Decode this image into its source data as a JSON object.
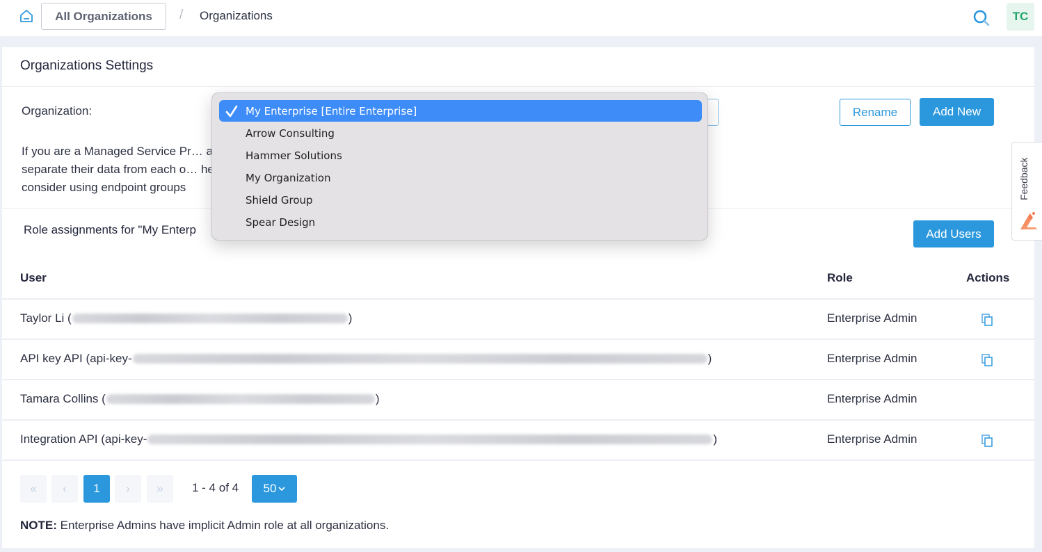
{
  "topbar": {
    "breadcrumb_root": "All Organizations",
    "breadcrumb_separator": "/",
    "breadcrumb_current": "Organizations",
    "avatar_initials": "TC",
    "icons": {
      "home": "home-icon",
      "search": "search-icon"
    }
  },
  "settings": {
    "title": "Organizations Settings",
    "organization_label": "Organization:",
    "selected_organization": "My Enterprise [Entire Enterprise]",
    "rename_label": "Rename",
    "add_new_label": "Add New",
    "description_lines": [
      "If you are a Managed Service Pr… ations to",
      "separate their data from each o… hem together,",
      "consider using endpoint groups"
    ],
    "role_assignments_title": "Role assignments for \"My Enterp",
    "add_users_label": "Add Users"
  },
  "dropdown": {
    "options": [
      {
        "label": "My Enterprise [Entire Enterprise]",
        "selected": true
      },
      {
        "label": "Arrow Consulting",
        "selected": false
      },
      {
        "label": "Hammer Solutions",
        "selected": false
      },
      {
        "label": "My Organization",
        "selected": false
      },
      {
        "label": "Shield Group",
        "selected": false
      },
      {
        "label": "Spear Design",
        "selected": false
      }
    ]
  },
  "table": {
    "columns": [
      "User",
      "Role",
      "Actions"
    ],
    "rows": [
      {
        "user_prefix": "Taylor Li (",
        "user_suffix": ")",
        "redacted": true,
        "role": "Enterprise Admin",
        "has_copy_action": true
      },
      {
        "user_prefix": "API key API (api-key-",
        "user_suffix": ")",
        "redacted": true,
        "role": "Enterprise Admin",
        "has_copy_action": true
      },
      {
        "user_prefix": "Tamara Collins (",
        "user_suffix": ")",
        "redacted": true,
        "role": "Enterprise Admin",
        "has_copy_action": false
      },
      {
        "user_prefix": "Integration API (api-key-",
        "user_suffix": ")",
        "redacted": true,
        "role": "Enterprise Admin",
        "has_copy_action": true
      }
    ]
  },
  "pagination": {
    "first": "«",
    "prev": "‹",
    "current_page": "1",
    "next": "›",
    "last": "»",
    "info": "1 - 4 of 4",
    "page_size": "50"
  },
  "note": {
    "label": "NOTE:",
    "text": " Enterprise Admins have implicit Admin role at all organizations."
  },
  "feedback": {
    "label": "Feedback"
  },
  "colors": {
    "accent": "#2b98dd",
    "avatar_bg": "#e6f6ee",
    "avatar_text": "#21a567",
    "dropdown_selected": "#3d8cf7"
  }
}
